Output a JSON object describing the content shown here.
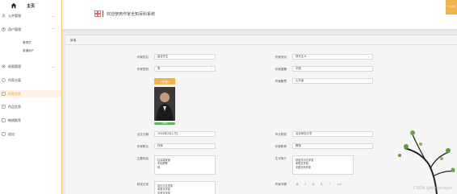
{
  "sidebar": {
    "brand": "主页",
    "items": [
      {
        "label": "公共管理",
        "icon": "people-icon",
        "expandable": true
      },
      {
        "label": "用户管理",
        "icon": "user-icon",
        "expandable": true
      },
      {
        "label": "权限管理",
        "icon": "gear-icon",
        "expandable": true
      },
      {
        "label": "作家分类",
        "icon": "tag-icon",
        "expandable": false
      },
      {
        "label": "作家信息",
        "icon": "book-icon",
        "expandable": false,
        "active": true
      },
      {
        "label": "作品信息",
        "icon": "doc-icon",
        "expandable": false
      },
      {
        "label": "畅销推荐",
        "icon": "star-icon",
        "expandable": false
      },
      {
        "label": "退出",
        "icon": "exit-icon",
        "expandable": false
      }
    ],
    "subitems": [
      "管理员",
      "普通用户"
    ]
  },
  "header": {
    "title": "欢迎使用作家全知百科系统",
    "corner_button": "个人中心"
  },
  "panel": {
    "title": "新增",
    "fields": {
      "author_name": {
        "label": "作家姓名",
        "value": "莫言先生"
      },
      "school": {
        "label": "作家流派",
        "value": "现代主义",
        "placeholder": "现代主义"
      },
      "gender": {
        "label": "作家性别",
        "value": "男"
      },
      "nationality": {
        "label": "作家国籍",
        "value": "中国"
      },
      "hometown": {
        "label": "作家籍贯",
        "value": "山东省"
      },
      "upload_label": "上传照片",
      "upload_progress": 100,
      "upload_progress_label": "100%",
      "birth_date": {
        "label": "出生日期",
        "value": "1955年2月17日"
      },
      "school_name": {
        "label": "毕业院校",
        "value": "北京师范大学"
      },
      "occupation": {
        "label": "作家职业",
        "value": "作家"
      },
      "title": {
        "label": "作家职称",
        "value": "教授"
      },
      "representative": {
        "label": "主要作品",
        "value": "红高粱家族\n丰乳肥臀\n蛙"
      },
      "awards": {
        "label": "生平简介",
        "value": "获诺贝尔文学奖\n茅盾文学奖\n中国当代作家"
      },
      "history": {
        "label": "获奖记录",
        "value": "诺贝尔文学奖\n茅盾文学奖\n华语文学奖"
      },
      "bio": {
        "label": "作家详情",
        "value": ""
      }
    },
    "editor_toolbar": [
      "B",
      "I",
      "U",
      "S",
      "“",
      "<>"
    ]
  },
  "watermark": "CSDN @biyezuopin"
}
